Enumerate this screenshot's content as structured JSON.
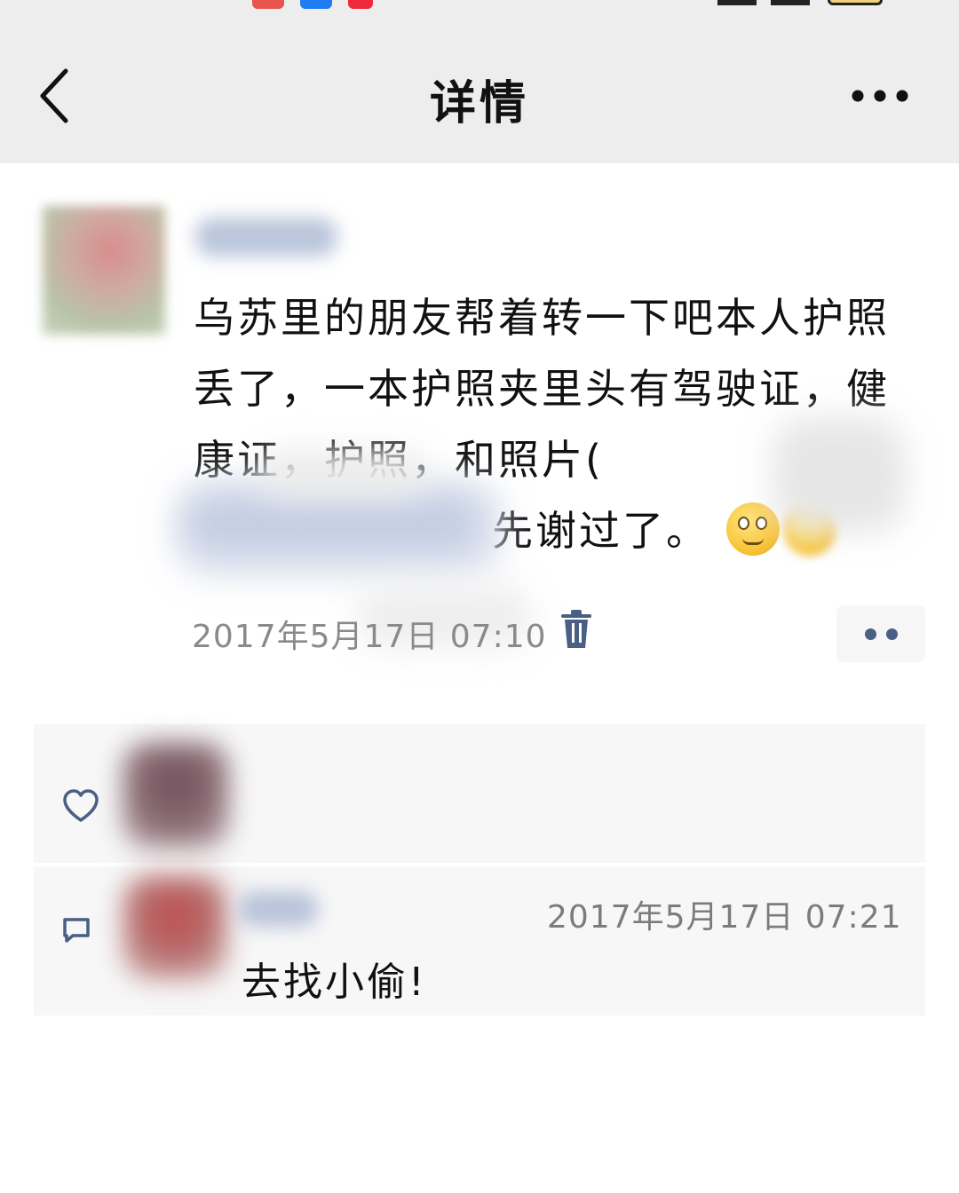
{
  "nav": {
    "title": "详情"
  },
  "post": {
    "text": "乌苏里的朋友帮着转一下吧本人护照丢了，一本护照夹里头有驾驶证，健康证，护照，和照片(",
    "text_tail": "先谢过了。",
    "timestamp": "2017年5月17日 07:10"
  },
  "likes": {
    "icon": "heart-outline-icon"
  },
  "comment": {
    "timestamp": "2017年5月17日 07:21",
    "text": "去找小偷!"
  },
  "colors": {
    "nav_bg": "#ededed",
    "accent_blue": "#4a5f84",
    "panel_bg": "#f7f7f7"
  }
}
